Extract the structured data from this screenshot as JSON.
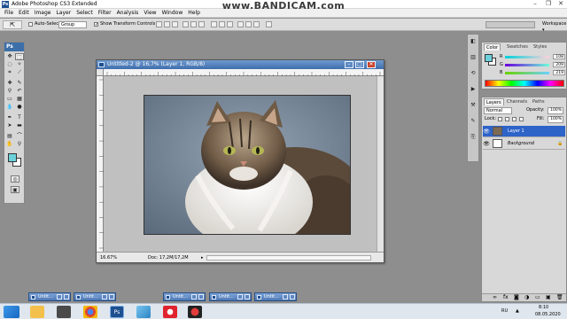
{
  "watermark": "www.BANDICAM.com",
  "app": {
    "title": "Adobe Photoshop CS3 Extended",
    "logo": "Ps"
  },
  "window_controls": {
    "minimize": "–",
    "maximize": "❐",
    "close": "✕"
  },
  "menu": [
    "File",
    "Edit",
    "Image",
    "Layer",
    "Select",
    "Filter",
    "Analysis",
    "View",
    "Window",
    "Help"
  ],
  "options": {
    "tool_icon": "move-tool-icon",
    "auto_select_label": "Auto-Select:",
    "auto_select_value": "Group",
    "show_transform_label": "Show Transform Controls",
    "workspace_label": "Workspace ▾"
  },
  "toolbox": {
    "header": "Ps"
  },
  "document": {
    "title": "Untitled-2 @ 16,7% (Layer 1, RGB/8)",
    "zoom": "16.67%",
    "doc_info": "Doc: 17,2M/17,2M",
    "ruler_top_ticks": [
      "0",
      "2",
      "4",
      "6",
      "8",
      "10",
      "12",
      "14",
      "16",
      "18",
      "20",
      "22",
      "24",
      "26",
      "28",
      "30",
      "32"
    ],
    "ruler_left_ticks": [
      "0",
      "2",
      "4",
      "6",
      "8",
      "10",
      "12",
      "14",
      "16",
      "18",
      "20",
      "22"
    ]
  },
  "color_panel": {
    "tabs": [
      "Color",
      "Swatches",
      "Styles"
    ],
    "channels": [
      {
        "label": "R",
        "value": "108"
      },
      {
        "label": "G",
        "value": "209"
      },
      {
        "label": "B",
        "value": "219"
      }
    ],
    "foreground": "#6cd1db",
    "background": "#ffffff"
  },
  "layers_panel": {
    "tabs": [
      "Layers",
      "Channels",
      "Paths"
    ],
    "blend_mode": "Normal",
    "opacity_label": "Opacity:",
    "opacity_value": "100%",
    "lock_label": "Lock:",
    "fill_label": "Fill:",
    "fill_value": "100%",
    "layers": [
      {
        "name": "Layer 1",
        "selected": true
      },
      {
        "name": "Background",
        "selected": false,
        "italic": true
      }
    ]
  },
  "minimized_docs": [
    {
      "title": "Untit..."
    },
    {
      "title": "Untit..."
    },
    {
      "title": "Untit..."
    },
    {
      "title": "Untit..."
    },
    {
      "title": "Untit..."
    }
  ],
  "tray": {
    "language": "RU",
    "time": "8:10",
    "date": "08.05.2020"
  }
}
